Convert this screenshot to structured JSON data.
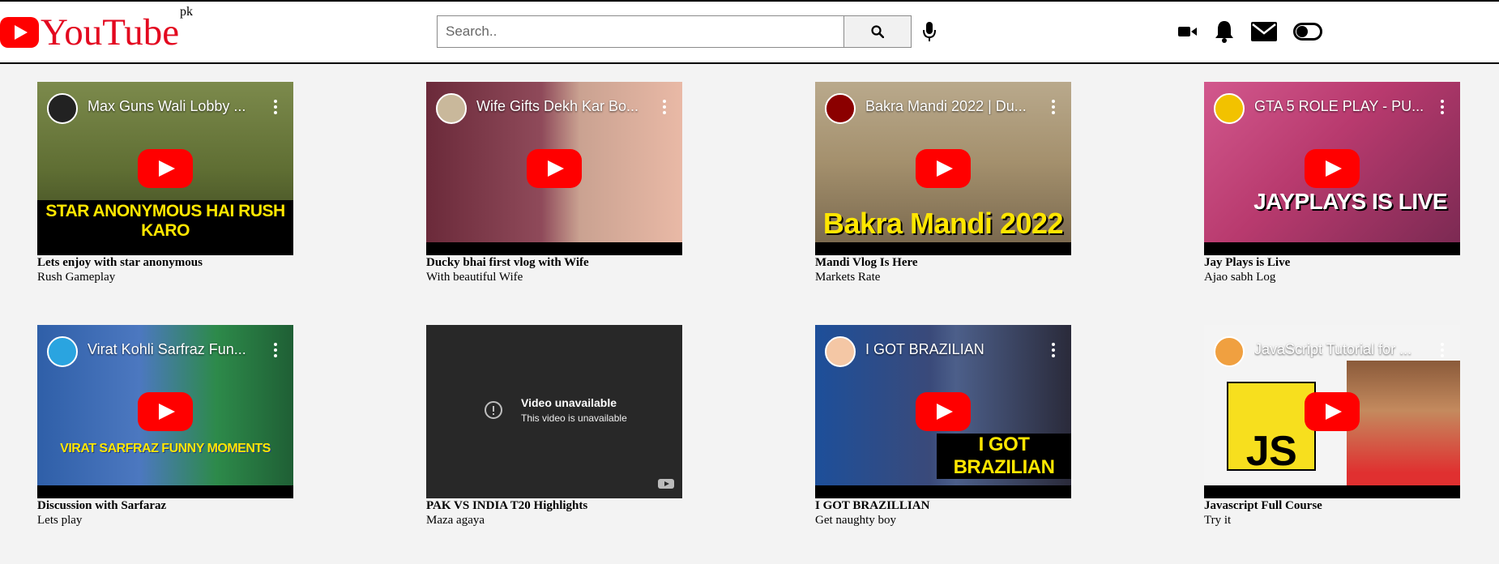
{
  "header": {
    "logo_text": "YouTube",
    "logo_country": "pk",
    "search_placeholder": "Search..",
    "icons": [
      "search-icon",
      "microphone-icon",
      "video-camera-icon",
      "bell-icon",
      "envelope-icon",
      "toggle-icon"
    ]
  },
  "videos": [
    {
      "thumb_title": "Max Guns Wali Lobby ...",
      "caption": "STAR ANONYMOUS HAI RUSH KARO",
      "title": "Lets enjoy with star anonymous",
      "subtitle": "Rush Gameplay",
      "bg": "#6e7d3f",
      "caption_color": "#ffe600"
    },
    {
      "thumb_title": "Wife Gifts Dekh Kar Bo...",
      "caption": "",
      "title": "Ducky bhai first vlog with Wife",
      "subtitle": "With beautiful Wife",
      "bg": "#8d3f4f",
      "caption_color": "#ffffff"
    },
    {
      "thumb_title": "Bakra Mandi 2022 | Du...",
      "caption": "Bakra Mandi 2022",
      "title": "Mandi Vlog Is Here",
      "subtitle": "Markets Rate",
      "bg": "#9b8a6d",
      "caption_color": "#ffe600"
    },
    {
      "thumb_title": "GTA 5 ROLE PLAY - PU...",
      "caption": "JAYPLAYS IS LIVE",
      "title": "Jay Plays is Live",
      "subtitle": "Ajao sabh Log",
      "bg": "#b83a6e",
      "caption_color": "#ffffff"
    },
    {
      "thumb_title": "Virat Kohli Sarfraz Fun...",
      "caption": "VIRAT SARFRAZ FUNNY MOMENTS",
      "title": "Discussion with Sarfaraz",
      "subtitle": "Lets play",
      "bg": "#2f5fa8",
      "caption_color": "#ffe600"
    },
    {
      "thumb_title": "",
      "caption": "",
      "title": "PAK VS INDIA T20 Highlights",
      "subtitle": "Maza agaya",
      "bg": "#282828",
      "caption_color": "#ffffff",
      "unavailable_title": "Video unavailable",
      "unavailable_sub": "This video is unavailable"
    },
    {
      "thumb_title": "I GOT BRAZILIAN",
      "caption": "I GOT BRAZILIAN",
      "title": "I GOT BRAZILLIAN",
      "subtitle": "Get naughty boy",
      "bg": "#3a4a7a",
      "caption_color": "#ffe600"
    },
    {
      "thumb_title": "JavaScript Tutorial for ...",
      "caption": "JS",
      "title": "Javascript Full Course",
      "subtitle": "Try it",
      "bg": "#f7df1e",
      "caption_color": "#000000"
    }
  ]
}
